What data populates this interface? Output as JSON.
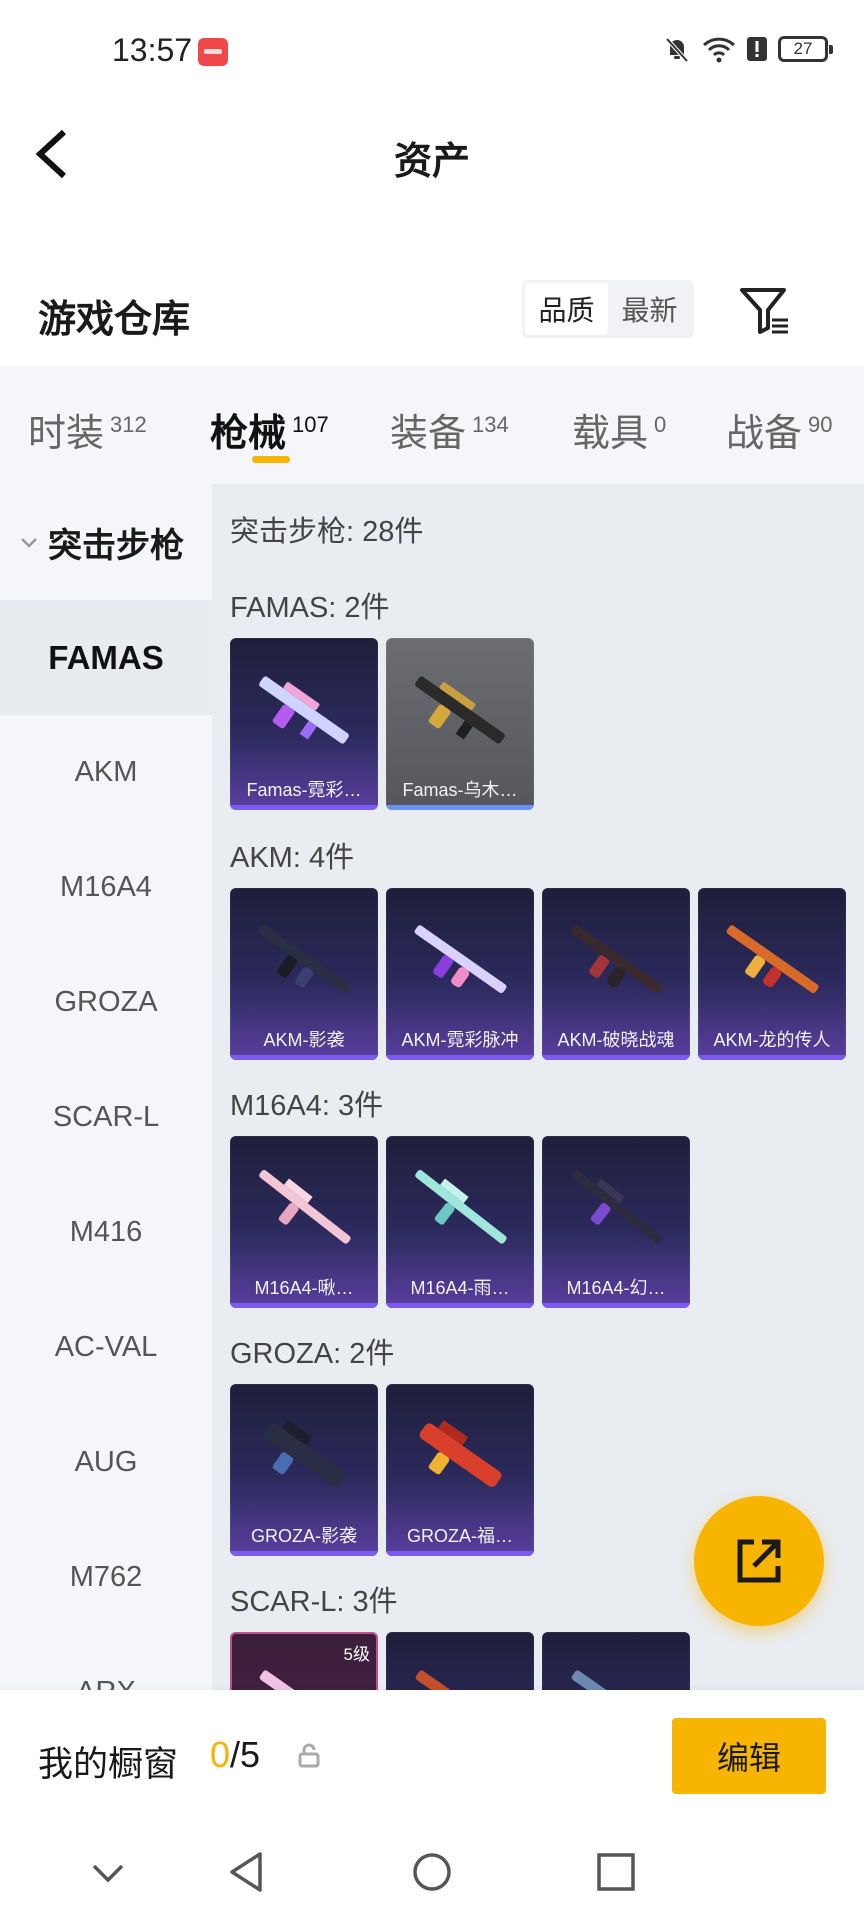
{
  "status": {
    "time": "13:57",
    "battery": "27"
  },
  "header": {
    "title": "资产"
  },
  "warehouse": {
    "title": "游戏仓库",
    "sort_options": [
      "品质",
      "最新"
    ],
    "sort_active": 0
  },
  "tabs": [
    {
      "label": "时装",
      "count": "312"
    },
    {
      "label": "枪械",
      "count": "107"
    },
    {
      "label": "装备",
      "count": "134"
    },
    {
      "label": "载具",
      "count": "0"
    },
    {
      "label": "战备",
      "count": "90"
    }
  ],
  "sidebar": {
    "group_label": "突击步枪",
    "items": [
      "FAMAS",
      "AKM",
      "M16A4",
      "GROZA",
      "SCAR-L",
      "M416",
      "AC-VAL",
      "AUG",
      "M762",
      "ARX"
    ]
  },
  "content": {
    "total": "突击步枪: 28件",
    "sections": [
      {
        "label": "FAMAS: 2件",
        "cards": [
          "Famas-霓彩…",
          "Famas-乌木…"
        ]
      },
      {
        "label": "AKM: 4件",
        "cards": [
          "AKM-影袭",
          "AKM-霓彩脉冲",
          "AKM-破晓战魂",
          "AKM-龙的传人"
        ]
      },
      {
        "label": "M16A4: 3件",
        "cards": [
          "M16A4-啾…",
          "M16A4-雨…",
          "M16A4-幻…"
        ]
      },
      {
        "label": "GROZA: 2件",
        "cards": [
          "GROZA-影袭",
          "GROZA-福…"
        ]
      },
      {
        "label": "SCAR-L: 3件",
        "cards": [
          "",
          "",
          ""
        ],
        "first_level": "5级"
      }
    ]
  },
  "showcase": {
    "label": "我的橱窗",
    "current": "0",
    "total": "/5",
    "edit_label": "编辑"
  }
}
